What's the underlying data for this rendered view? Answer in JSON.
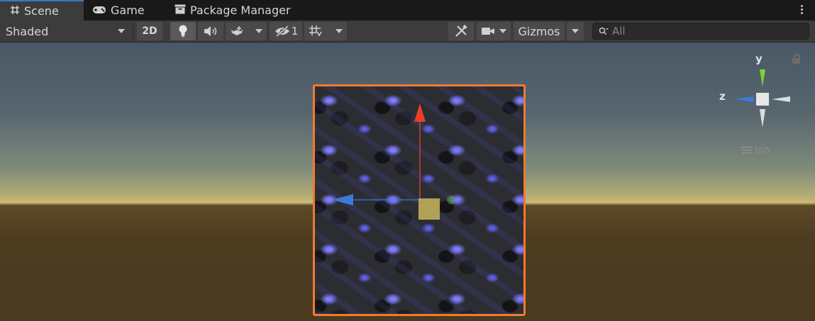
{
  "tabs": [
    {
      "label": "Scene",
      "icon": "grid-icon",
      "active": true
    },
    {
      "label": "Game",
      "icon": "gamepad-icon",
      "active": false
    },
    {
      "label": "Package Manager",
      "icon": "package-icon",
      "active": false
    }
  ],
  "toolbar": {
    "draw_mode": "Shaded",
    "mode_2d": "2D",
    "hidden_count": "1",
    "gizmos": "Gizmos"
  },
  "search": {
    "placeholder": "All"
  },
  "orientation_gizmo": {
    "y_label": "y",
    "z_label": "z",
    "projection": "Iso"
  },
  "colors": {
    "accent": "#3a79bb",
    "selection_outline": "#f07b2e",
    "x_axis": "#e8402c",
    "y_axis": "#7fd32c",
    "z_axis": "#3a7bd8"
  }
}
